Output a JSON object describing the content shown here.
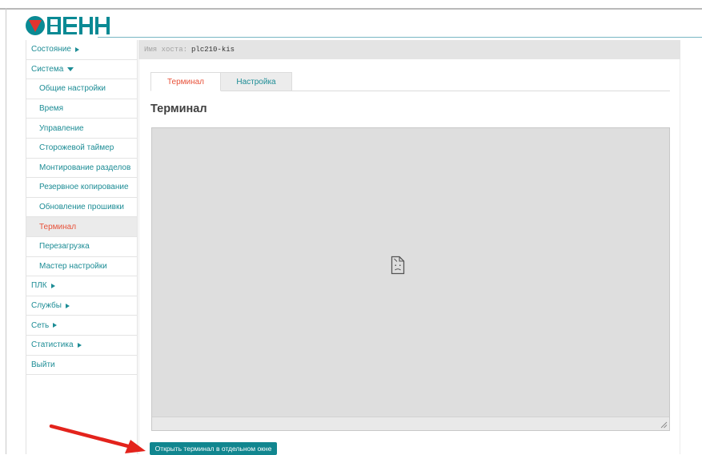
{
  "brand": {
    "logo_text": "ОВЕН",
    "logo_icon": "oven-logo-icon",
    "brand_color": "#0a8a94",
    "accent_color": "#e3342f"
  },
  "sidebar": {
    "items": [
      {
        "label": "Состояние",
        "level": 0,
        "indicator": "arrow-right",
        "active": false
      },
      {
        "label": "Система",
        "level": 0,
        "indicator": "arrow-down",
        "active": false
      },
      {
        "label": "Общие настройки",
        "level": 1,
        "active": false
      },
      {
        "label": "Время",
        "level": 1,
        "active": false
      },
      {
        "label": "Управление",
        "level": 1,
        "active": false
      },
      {
        "label": "Сторожевой таймер",
        "level": 1,
        "active": false
      },
      {
        "label": "Монтирование разделов",
        "level": 1,
        "active": false
      },
      {
        "label": "Резервное копирование",
        "level": 1,
        "active": false
      },
      {
        "label": "Обновление прошивки",
        "level": 1,
        "active": false
      },
      {
        "label": "Терминал",
        "level": 1,
        "active": true
      },
      {
        "label": "Перезагрузка",
        "level": 1,
        "active": false
      },
      {
        "label": "Мастер настройки",
        "level": 1,
        "active": false
      },
      {
        "label": "ПЛК",
        "level": 0,
        "indicator": "arrow-right",
        "active": false
      },
      {
        "label": "Службы",
        "level": 0,
        "indicator": "arrow-right",
        "active": false
      },
      {
        "label": "Сеть",
        "level": 0,
        "indicator": "arrow-right",
        "active": false
      },
      {
        "label": "Статистика",
        "level": 0,
        "indicator": "arrow-right",
        "active": false
      },
      {
        "label": "Выйти",
        "level": 0,
        "active": false
      }
    ]
  },
  "host": {
    "label": "Имя хоста:",
    "value": "plc210-kis"
  },
  "tabs": [
    {
      "label": "Терминал",
      "active": true
    },
    {
      "label": "Настройка",
      "active": false
    }
  ],
  "main": {
    "title": "Терминал",
    "frame_icon": "broken-document-icon",
    "open_button_label": "Открыть терминал в отдельном окне"
  },
  "annotation": {
    "icon": "red-arrow-icon",
    "color": "#e3231c"
  },
  "colors": {
    "link": "#1c8c95",
    "active": "#e8523a",
    "button_bg": "#11868f"
  }
}
